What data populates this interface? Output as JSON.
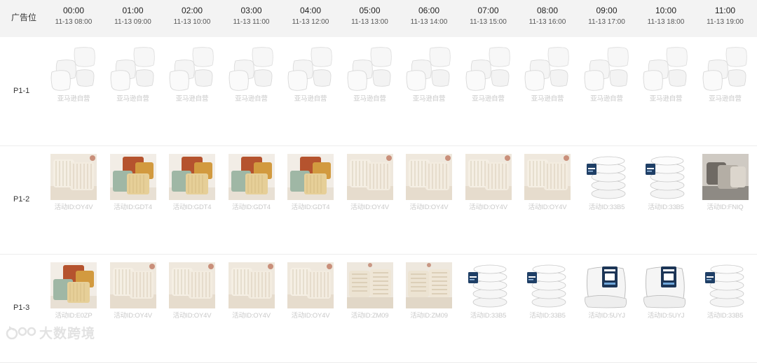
{
  "header": {
    "slot_label": "广告位",
    "columns": [
      {
        "time": "00:00",
        "date": "11-13 08:00"
      },
      {
        "time": "01:00",
        "date": "11-13 09:00"
      },
      {
        "time": "02:00",
        "date": "11-13 10:00"
      },
      {
        "time": "03:00",
        "date": "11-13 11:00"
      },
      {
        "time": "04:00",
        "date": "11-13 12:00"
      },
      {
        "time": "05:00",
        "date": "11-13 13:00"
      },
      {
        "time": "06:00",
        "date": "11-13 14:00"
      },
      {
        "time": "07:00",
        "date": "11-13 15:00"
      },
      {
        "time": "08:00",
        "date": "11-13 16:00"
      },
      {
        "time": "09:00",
        "date": "11-13 17:00"
      },
      {
        "time": "10:00",
        "date": "11-13 18:00"
      },
      {
        "time": "11:00",
        "date": "11-13 19:00"
      }
    ]
  },
  "rows": [
    {
      "label": "P1-1",
      "cells": [
        {
          "img": "white-pillow-group-icon",
          "caption": "亚马逊自营"
        },
        {
          "img": "white-pillow-group-icon",
          "caption": "亚马逊自营"
        },
        {
          "img": "white-pillow-group-icon",
          "caption": "亚马逊自营"
        },
        {
          "img": "white-pillow-group-icon",
          "caption": "亚马逊自营"
        },
        {
          "img": "white-pillow-group-icon",
          "caption": "亚马逊自营"
        },
        {
          "img": "white-pillow-group-icon",
          "caption": "亚马逊自营"
        },
        {
          "img": "white-pillow-group-icon",
          "caption": "亚马逊自营"
        },
        {
          "img": "white-pillow-group-icon",
          "caption": "亚马逊自营"
        },
        {
          "img": "white-pillow-group-icon",
          "caption": "亚马逊自营"
        },
        {
          "img": "white-pillow-group-icon",
          "caption": "亚马逊自营"
        },
        {
          "img": "white-pillow-group-icon",
          "caption": "亚马逊自营"
        },
        {
          "img": "white-pillow-group-icon",
          "caption": "亚马逊自营"
        }
      ]
    },
    {
      "label": "P1-2",
      "cells": [
        {
          "img": "cream-striped-pillow-icon",
          "caption": "活动ID:OY4V"
        },
        {
          "img": "colorful-pillow-set-icon",
          "caption": "活动ID:GDT4"
        },
        {
          "img": "colorful-pillow-set-icon",
          "caption": "活动ID:GDT4"
        },
        {
          "img": "colorful-pillow-set-icon",
          "caption": "活动ID:GDT4"
        },
        {
          "img": "colorful-pillow-set-icon",
          "caption": "活动ID:GDT4"
        },
        {
          "img": "cream-striped-pillow-icon",
          "caption": "活动ID:OY4V"
        },
        {
          "img": "cream-striped-pillow-icon",
          "caption": "活动ID:OY4V"
        },
        {
          "img": "cream-striped-pillow-icon",
          "caption": "活动ID:OY4V"
        },
        {
          "img": "cream-striped-pillow-icon",
          "caption": "活动ID:OY4V"
        },
        {
          "img": "white-pillow-stack-icon",
          "caption": "活动ID:33B5"
        },
        {
          "img": "white-pillow-stack-icon",
          "caption": "活动ID:33B5"
        },
        {
          "img": "gray-pillow-pair-icon",
          "caption": "活动ID:FNIQ"
        }
      ]
    },
    {
      "label": "P1-3",
      "cells": [
        {
          "img": "colorful-pillow-set-icon",
          "caption": "活动ID:E0ZP"
        },
        {
          "img": "cream-striped-pillow-icon",
          "caption": "活动ID:OY4V"
        },
        {
          "img": "cream-striped-pillow-icon",
          "caption": "活动ID:OY4V"
        },
        {
          "img": "cream-striped-pillow-icon",
          "caption": "活动ID:OY4V"
        },
        {
          "img": "cream-striped-pillow-icon",
          "caption": "活动ID:OY4V"
        },
        {
          "img": "beige-textured-pillow-icon",
          "caption": "活动ID:ZM09"
        },
        {
          "img": "beige-textured-pillow-icon",
          "caption": "活动ID:ZM09"
        },
        {
          "img": "white-pillow-stack-icon",
          "caption": "活动ID:33B5"
        },
        {
          "img": "white-pillow-stack-icon",
          "caption": "活动ID:33B5"
        },
        {
          "img": "white-pillow-insert-tag-icon",
          "caption": "活动ID:5UYJ"
        },
        {
          "img": "white-pillow-insert-tag-icon",
          "caption": "活动ID:5UYJ"
        },
        {
          "img": "white-pillow-stack-icon",
          "caption": "活动ID:33B5"
        }
      ]
    }
  ],
  "watermark": {
    "text": "大数跨境",
    "icon": "brand-logo-icon"
  }
}
